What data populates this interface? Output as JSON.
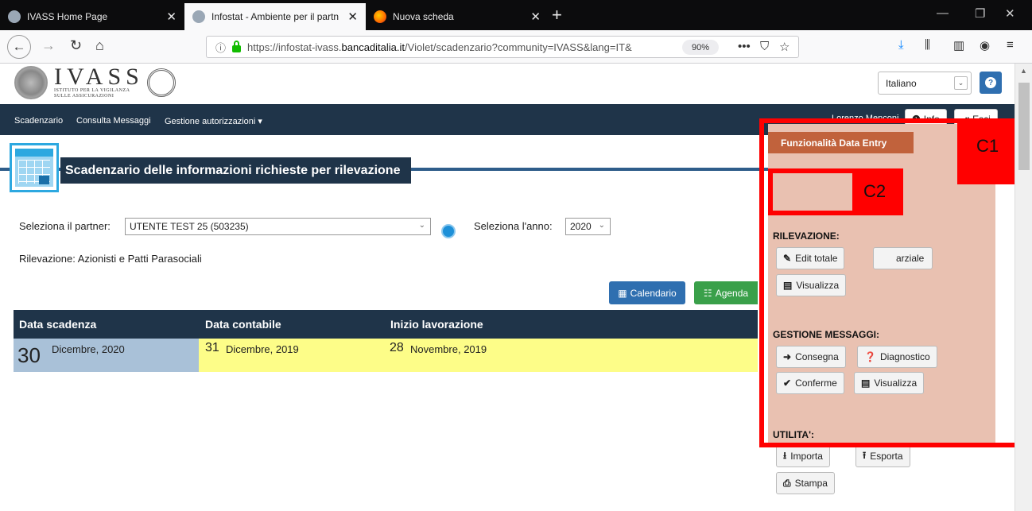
{
  "browser": {
    "tabs": [
      {
        "title": "IVASS Home Page",
        "active": false
      },
      {
        "title": "Infostat - Ambiente per il partn",
        "active": true
      },
      {
        "title": "Nuova scheda",
        "active": false
      }
    ],
    "url_prefix": "https://infostat-ivass.",
    "url_domain": "bancaditalia.it",
    "url_suffix": "/Violet/scadenzario?community=IVASS&lang=IT&",
    "zoom": "90%"
  },
  "header": {
    "logo_text": "IVASS",
    "logo_sub1": "ISTITUTO PER LA VIGILANZA",
    "logo_sub2": "SULLE ASSICURAZIONI",
    "language": "Italiano"
  },
  "menu": {
    "items": [
      "Scadenzario",
      "Consulta Messaggi",
      "Gestione autorizzazioni ▾"
    ],
    "user": "Lorenzo Menconi",
    "info_label": "Info",
    "exit_label": "Esci"
  },
  "main": {
    "title": "Scadenzario delle informazioni richieste per rilevazione",
    "partner_label": "Seleziona il partner:",
    "partner_value": "UTENTE TEST 25 (503235)",
    "year_label": "Seleziona l'anno:",
    "year_value": "2020",
    "rilevazione": "Rilevazione: Azionisti e Patti Parasociali",
    "calendar_btn": "Calendario",
    "agenda_btn": "Agenda",
    "columns": [
      "Data scadenza",
      "Data contabile",
      "Inizio lavorazione"
    ],
    "row": {
      "scad_day": "30",
      "scad_rest": "Dicembre, 2020",
      "cont_day": "31",
      "cont_rest": "Dicembre, 2019",
      "inizio_day": "28",
      "inizio_rest": "Novembre, 2019"
    }
  },
  "panel": {
    "title": "Funzionalità Data Entry",
    "sec_rilevazione": "RILEVAZIONE:",
    "edit_totale": "Edit totale",
    "edit_parziale": "arziale",
    "visualizza1": "Visualizza",
    "sec_messaggi": "GESTIONE MESSAGGI:",
    "consegna": "Consegna",
    "diagnostico": "Diagnostico",
    "conferme": "Conferme",
    "visualizza2": "Visualizza",
    "sec_utilita": "UTILITA':",
    "importa": "Importa",
    "esporta": "Esporta",
    "stampa": "Stampa"
  },
  "annotations": {
    "c1": "C1",
    "c2": "C2"
  },
  "colors": {
    "accent": "#1f3449",
    "panel": "#e9c1b1",
    "highlight": "#ff0000"
  }
}
